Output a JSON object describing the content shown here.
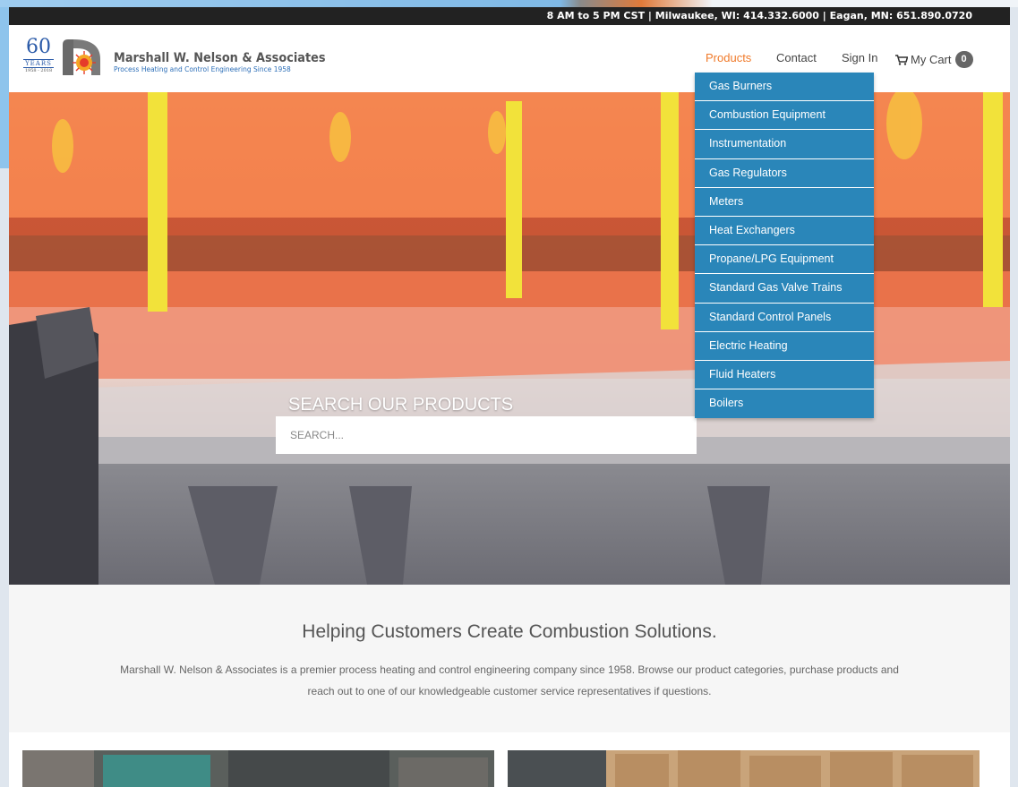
{
  "topbar": {
    "info": "8 AM to 5 PM CST | Milwaukee, WI: 414.332.6000 | Eagan, MN: 651.890.0720"
  },
  "logo": {
    "anniversary_number": "60",
    "anniversary_label": "YEARS",
    "anniversary_range": "1958 - 2018"
  },
  "brand": {
    "name": "Marshall W. Nelson & Associates",
    "tagline": "Process Heating and Control Engineering Since 1958"
  },
  "nav": {
    "products": "Products",
    "contact": "Contact",
    "signin": "Sign In",
    "cart": "My Cart",
    "cart_count": "0"
  },
  "products_menu": [
    "Gas Burners",
    "Combustion Equipment",
    "Instrumentation",
    "Gas Regulators",
    "Meters",
    "Heat Exchangers",
    "Propane/LPG Equipment",
    "Standard Gas Valve Trains",
    "Standard Control Panels",
    "Electric Heating",
    "Fluid Heaters",
    "Boilers"
  ],
  "search": {
    "title": "SEARCH OUR PRODUCTS",
    "placeholder": "SEARCH..."
  },
  "intro": {
    "title": "Helping Customers Create Combustion Solutions.",
    "text": "Marshall W. Nelson & Associates is a premier process heating and control engineering company since 1958. Browse our product categories, purchase products and reach out to one of our knowledgeable customer service representatives if questions."
  },
  "colors": {
    "accent": "#f07a2a",
    "menu": "#2a86b9",
    "topbar": "#222222"
  }
}
